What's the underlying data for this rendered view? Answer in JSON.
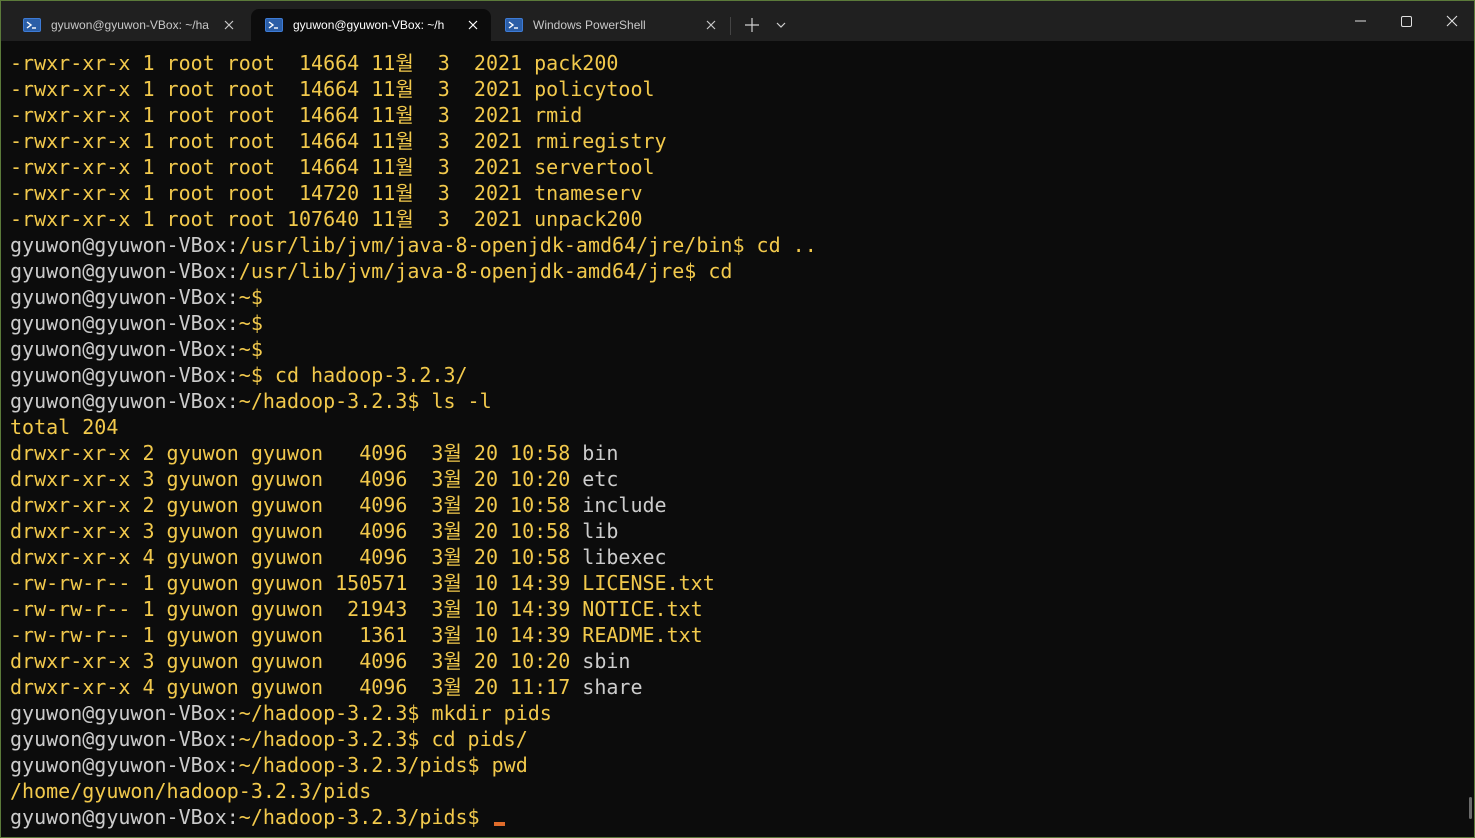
{
  "tabs": [
    {
      "title": "gyuwon@gyuwon-VBox: ~/ha",
      "icon": "powershell-icon",
      "active": false
    },
    {
      "title": "gyuwon@gyuwon-VBox: ~/h",
      "icon": "powershell-icon",
      "active": true
    },
    {
      "title": "Windows PowerShell",
      "icon": "powershell-icon",
      "active": false
    }
  ],
  "colors": {
    "background": "#0c0c0c",
    "titlebar": "#202020",
    "yellow_text": "#f2c94c",
    "white_text": "#cccccc",
    "cursor": "#e06c2b"
  },
  "terminal": {
    "lines": [
      [
        {
          "t": "-rwxr-xr-x 1 root root  14664 11월  3  2021 ",
          "c": "y"
        },
        {
          "t": "pack200",
          "c": "y"
        }
      ],
      [
        {
          "t": "-rwxr-xr-x 1 root root  14664 11월  3  2021 ",
          "c": "y"
        },
        {
          "t": "policytool",
          "c": "y"
        }
      ],
      [
        {
          "t": "-rwxr-xr-x 1 root root  14664 11월  3  2021 ",
          "c": "y"
        },
        {
          "t": "rmid",
          "c": "y"
        }
      ],
      [
        {
          "t": "-rwxr-xr-x 1 root root  14664 11월  3  2021 ",
          "c": "y"
        },
        {
          "t": "rmiregistry",
          "c": "y"
        }
      ],
      [
        {
          "t": "-rwxr-xr-x 1 root root  14664 11월  3  2021 ",
          "c": "y"
        },
        {
          "t": "servertool",
          "c": "y"
        }
      ],
      [
        {
          "t": "-rwxr-xr-x 1 root root  14720 11월  3  2021 ",
          "c": "y"
        },
        {
          "t": "tnameserv",
          "c": "y"
        }
      ],
      [
        {
          "t": "-rwxr-xr-x 1 root root 107640 11월  3  2021 ",
          "c": "y"
        },
        {
          "t": "unpack200",
          "c": "y"
        }
      ],
      [
        {
          "t": "gyuwon@gyuwon-VBox:",
          "c": "w"
        },
        {
          "t": "/usr/lib/jvm/java-8-openjdk-amd64/jre/bin$ cd ..",
          "c": "y"
        }
      ],
      [
        {
          "t": "gyuwon@gyuwon-VBox:",
          "c": "w"
        },
        {
          "t": "/usr/lib/jvm/java-8-openjdk-amd64/jre$ cd",
          "c": "y"
        }
      ],
      [
        {
          "t": "gyuwon@gyuwon-VBox:",
          "c": "w"
        },
        {
          "t": "~$",
          "c": "y"
        }
      ],
      [
        {
          "t": "gyuwon@gyuwon-VBox:",
          "c": "w"
        },
        {
          "t": "~$",
          "c": "y"
        }
      ],
      [
        {
          "t": "gyuwon@gyuwon-VBox:",
          "c": "w"
        },
        {
          "t": "~$",
          "c": "y"
        }
      ],
      [
        {
          "t": "gyuwon@gyuwon-VBox:",
          "c": "w"
        },
        {
          "t": "~$ cd hadoop-3.2.3/",
          "c": "y"
        }
      ],
      [
        {
          "t": "gyuwon@gyuwon-VBox:",
          "c": "w"
        },
        {
          "t": "~/hadoop-3.2.3$ ls -l",
          "c": "y"
        }
      ],
      [
        {
          "t": "total 204",
          "c": "y"
        }
      ],
      [
        {
          "t": "drwxr-xr-x 2 gyuwon gyuwon   4096  3월 20 10:58 ",
          "c": "y"
        },
        {
          "t": "bin",
          "c": "w"
        }
      ],
      [
        {
          "t": "drwxr-xr-x 3 gyuwon gyuwon   4096  3월 20 10:20 ",
          "c": "y"
        },
        {
          "t": "etc",
          "c": "w"
        }
      ],
      [
        {
          "t": "drwxr-xr-x 2 gyuwon gyuwon   4096  3월 20 10:58 ",
          "c": "y"
        },
        {
          "t": "include",
          "c": "w"
        }
      ],
      [
        {
          "t": "drwxr-xr-x 3 gyuwon gyuwon   4096  3월 20 10:58 ",
          "c": "y"
        },
        {
          "t": "lib",
          "c": "w"
        }
      ],
      [
        {
          "t": "drwxr-xr-x 4 gyuwon gyuwon   4096  3월 20 10:58 ",
          "c": "y"
        },
        {
          "t": "libexec",
          "c": "w"
        }
      ],
      [
        {
          "t": "-rw-rw-r-- 1 gyuwon gyuwon 150571  3월 10 14:39 ",
          "c": "y"
        },
        {
          "t": "LICENSE.txt",
          "c": "y"
        }
      ],
      [
        {
          "t": "-rw-rw-r-- 1 gyuwon gyuwon  21943  3월 10 14:39 ",
          "c": "y"
        },
        {
          "t": "NOTICE.txt",
          "c": "y"
        }
      ],
      [
        {
          "t": "-rw-rw-r-- 1 gyuwon gyuwon   1361  3월 10 14:39 ",
          "c": "y"
        },
        {
          "t": "README.txt",
          "c": "y"
        }
      ],
      [
        {
          "t": "drwxr-xr-x 3 gyuwon gyuwon   4096  3월 20 10:20 ",
          "c": "y"
        },
        {
          "t": "sbin",
          "c": "w"
        }
      ],
      [
        {
          "t": "drwxr-xr-x 4 gyuwon gyuwon   4096  3월 20 11:17 ",
          "c": "y"
        },
        {
          "t": "share",
          "c": "w"
        }
      ],
      [
        {
          "t": "gyuwon@gyuwon-VBox:",
          "c": "w"
        },
        {
          "t": "~/hadoop-3.2.3$ mkdir pids",
          "c": "y"
        }
      ],
      [
        {
          "t": "gyuwon@gyuwon-VBox:",
          "c": "w"
        },
        {
          "t": "~/hadoop-3.2.3$ cd pids/",
          "c": "y"
        }
      ],
      [
        {
          "t": "gyuwon@gyuwon-VBox:",
          "c": "w"
        },
        {
          "t": "~/hadoop-3.2.3/pids$ pwd",
          "c": "y"
        }
      ],
      [
        {
          "t": "/home/gyuwon/hadoop-3.2.3/pids",
          "c": "y"
        }
      ],
      [
        {
          "t": "gyuwon@gyuwon-VBox:",
          "c": "w"
        },
        {
          "t": "~/hadoop-3.2.3/pids$ ",
          "c": "y"
        }
      ]
    ]
  }
}
